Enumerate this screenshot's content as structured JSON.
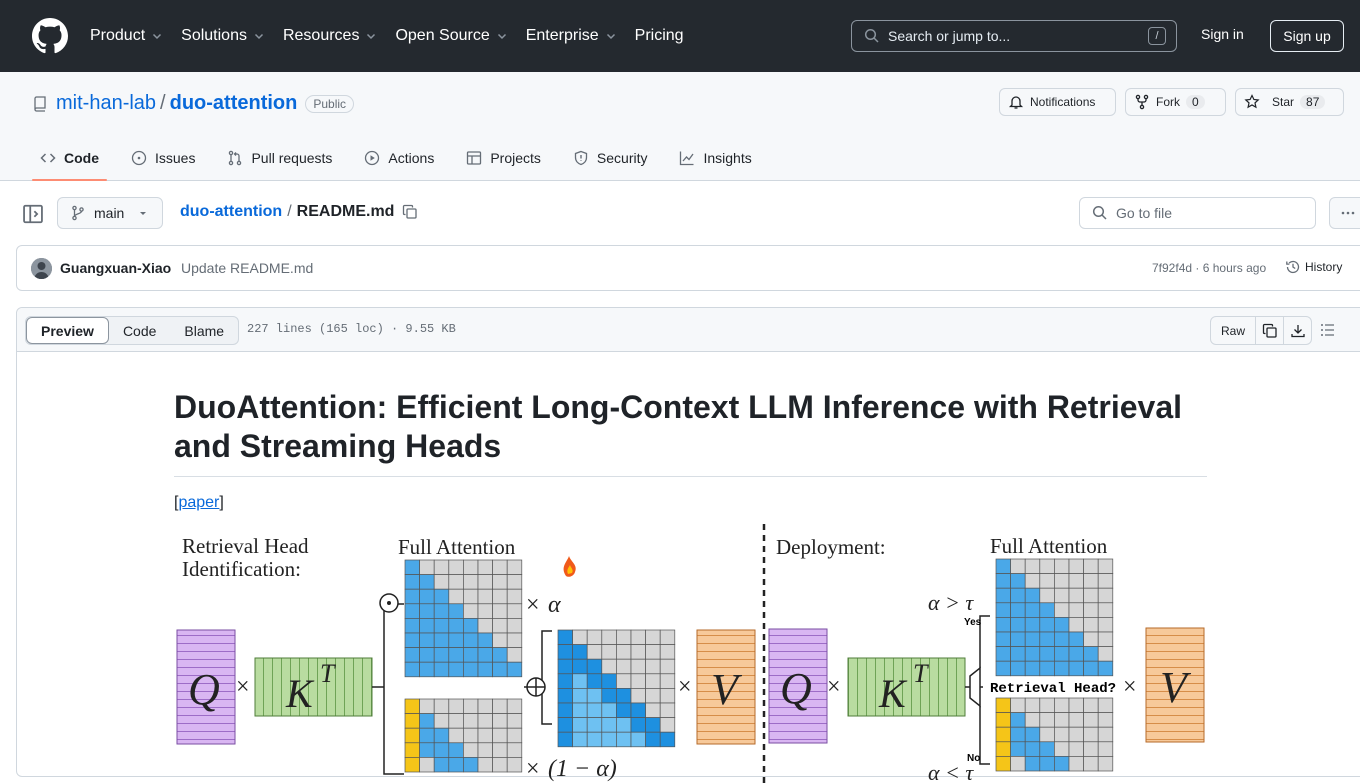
{
  "header": {
    "nav": [
      "Product",
      "Solutions",
      "Resources",
      "Open Source",
      "Enterprise",
      "Pricing"
    ],
    "search_placeholder": "Search or jump to...",
    "search_key": "/",
    "sign_in": "Sign in",
    "sign_up": "Sign up"
  },
  "repo": {
    "owner": "mit-han-lab",
    "name": "duo-attention",
    "visibility": "Public",
    "notifications": "Notifications",
    "fork_label": "Fork",
    "fork_count": "0",
    "star_label": "Star",
    "star_count": "87",
    "tabs": [
      "Code",
      "Issues",
      "Pull requests",
      "Actions",
      "Projects",
      "Security",
      "Insights"
    ]
  },
  "file": {
    "branch": "main",
    "repo_crumb": "duo-attention",
    "file_name": "README.md",
    "goto_placeholder": "Go to file",
    "commit_author": "Guangxuan-Xiao",
    "commit_message": "Update README.md",
    "commit_hash": "7f92f4d",
    "commit_sep": "·",
    "commit_time": "6 hours ago",
    "history": "History",
    "view_tabs": [
      "Preview",
      "Code",
      "Blame"
    ],
    "meta": "227 lines (165 loc) · 9.55 KB",
    "raw": "Raw"
  },
  "readme": {
    "title": "DuoAttention: Efficient Long-Context LLM Inference with Retrieval and Streaming Heads",
    "paper_open": "[",
    "paper_link": "paper",
    "paper_close": "]",
    "figure": {
      "left_title_1": "Retrieval Head",
      "left_title_2": "Identification:",
      "full_attention": "Full Attention",
      "deployment": "Deployment:",
      "full_attention_2": "Full Attention",
      "q": "Q",
      "kt": "K",
      "t": "T",
      "v": "V",
      "times": "×",
      "alpha": "α",
      "one_minus_alpha": "(1 − α)",
      "alpha_gt_tau": "α > τ",
      "alpha_lt_tau": "α < τ",
      "yes": "Yes",
      "no": "No",
      "retrieval_head_q": "Retrieval Head?"
    }
  }
}
